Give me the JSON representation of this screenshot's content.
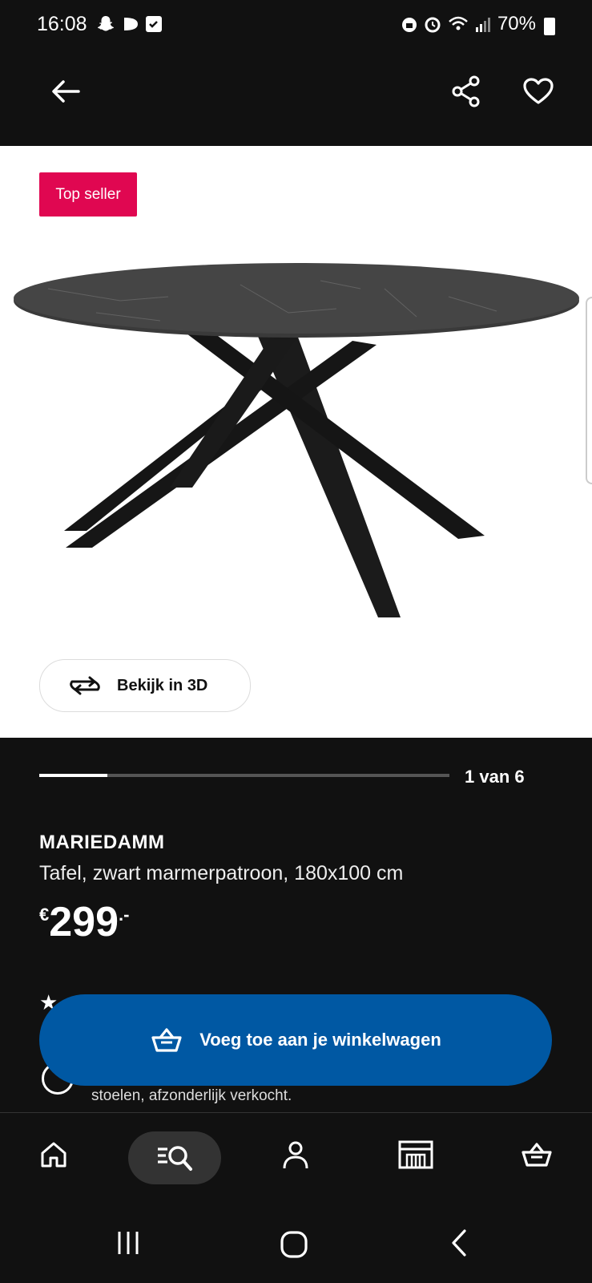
{
  "status_bar": {
    "time": "16:08",
    "battery": "70%"
  },
  "product": {
    "badge": "Top seller",
    "view_3d_label": "Bekijk in 3D",
    "image_counter": "1 van 6",
    "image_progress": 0.166,
    "name": "MARIEDAMM",
    "description": "Tafel, zwart marmerpatroon, 180x100 cm",
    "price": {
      "currency": "€",
      "amount": "299",
      "suffix": ".-"
    },
    "note": "stoelen, afzonderlijk verkocht."
  },
  "cart_button": {
    "label": "Voeg toe aan je winkelwagen"
  },
  "colors": {
    "accent": "#0058a3",
    "badge": "#e00751",
    "background": "#111111"
  },
  "bottom_nav": [
    "home-icon",
    "search-icon",
    "account-icon",
    "store-icon",
    "cart-icon"
  ],
  "icons": {
    "appbar": [
      "back-arrow-icon",
      "share-icon",
      "heart-icon"
    ],
    "system_nav": [
      "recent-apps-icon",
      "home-circle-icon",
      "system-back-icon"
    ]
  }
}
